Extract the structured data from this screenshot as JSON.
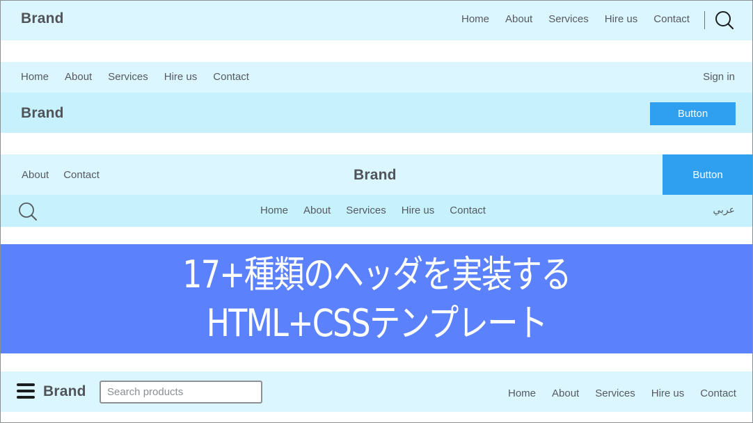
{
  "colors": {
    "header_light": "#dbf6ff",
    "header_mid": "#c6f1fd",
    "button": "#2f9ff0",
    "banner": "#5b82fc",
    "text": "#555a5f"
  },
  "header1": {
    "brand": "Brand",
    "nav": [
      "Home",
      "About",
      "Services",
      "Hire us",
      "Contact"
    ],
    "search_icon": "search-icon"
  },
  "header2": {
    "nav": [
      "Home",
      "About",
      "Services",
      "Hire us",
      "Contact"
    ],
    "sign_in": "Sign in",
    "brand": "Brand",
    "button": "Button"
  },
  "header3": {
    "left_nav": [
      "About",
      "Contact"
    ],
    "brand": "Brand",
    "button": "Button",
    "search_icon": "search-icon",
    "nav": [
      "Home",
      "About",
      "Services",
      "Hire us",
      "Contact"
    ],
    "language": "عربي"
  },
  "banner": {
    "line1": "17+種類のヘッダを実装する",
    "line2": "HTML+CSSテンプレート"
  },
  "header4": {
    "menu_icon": "hamburger-menu-icon",
    "brand": "Brand",
    "search_placeholder": "Search products",
    "search_value": "",
    "nav": [
      "Home",
      "About",
      "Services",
      "Hire us",
      "Contact"
    ]
  }
}
